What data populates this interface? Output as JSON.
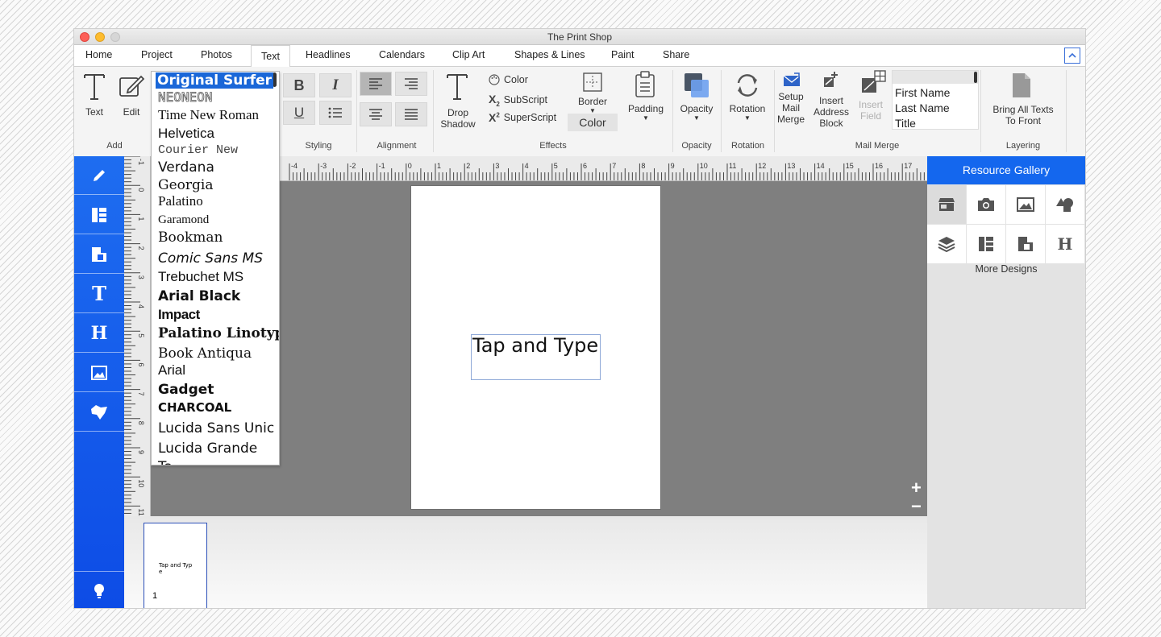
{
  "window": {
    "title": "The Print Shop"
  },
  "menu": [
    {
      "label": "Home"
    },
    {
      "label": "Project"
    },
    {
      "label": "Photos"
    },
    {
      "label": "Text"
    },
    {
      "label": "Headlines"
    },
    {
      "label": "Calendars"
    },
    {
      "label": "Clip Art"
    },
    {
      "label": "Shapes & Lines"
    },
    {
      "label": "Paint"
    },
    {
      "label": "Share"
    }
  ],
  "active_menu": "Text",
  "ribbon": {
    "add": {
      "text_label": "Text",
      "edit_label": "Edit",
      "group": "Add"
    },
    "styling_group": "Styling",
    "alignment_group": "Alignment",
    "effects": {
      "drop_shadow_1": "Drop",
      "drop_shadow_2": "Shadow",
      "color": "Color",
      "subscript": "SubScript",
      "superscript": "SuperScript",
      "border": "Border",
      "border_color": "Color",
      "padding": "Padding",
      "group": "Effects"
    },
    "opacity": {
      "label": "Opacity",
      "group": "Opacity"
    },
    "rotation": {
      "label": "Rotation",
      "group": "Rotation"
    },
    "mail_merge": {
      "setup_1": "Setup",
      "setup_2": "Mail",
      "setup_3": "Merge",
      "insert_1": "Insert",
      "insert_2": "Address",
      "insert_3": "Block",
      "field_1": "Insert",
      "field_2": "Field",
      "fields": [
        "First Name",
        "Last Name",
        "Title"
      ],
      "group": "Mail Merge"
    },
    "layering": {
      "label_1": "Bring All Texts",
      "label_2": "To Front",
      "group": "Layering"
    }
  },
  "fonts": [
    "Original Surfer",
    "NEONEON",
    "Time New Roman",
    "Helvetica",
    "Courier New",
    "Verdana",
    "Georgia",
    "Palatino",
    "Garamond",
    "Bookman",
    "Comic Sans MS",
    "Trebuchet MS",
    "Arial Black",
    "Impact",
    "Palatino Linotype",
    "Book Antiqua",
    "Arial",
    "Gadget",
    "CHARCOAL",
    "Lucida Sans Unic",
    "Lucida Grande",
    "Ta"
  ],
  "selected_font": "Original Surfer",
  "ruler": {
    "h_ticks": [
      "-4",
      "-3",
      "-2",
      "-1",
      "0",
      "1",
      "2",
      "3",
      "4",
      "5",
      "6",
      "7",
      "8",
      "9",
      "10",
      "11",
      "12",
      "13",
      "14",
      "15",
      "16",
      "17"
    ],
    "v_ticks": [
      "-1",
      "0",
      "1",
      "2",
      "3",
      "4",
      "5",
      "6",
      "7",
      "8",
      "9",
      "10",
      "11"
    ]
  },
  "canvas": {
    "text": "Tap and Type",
    "zoom_in": "+",
    "zoom_out": "−"
  },
  "thumbnails": [
    {
      "text": "Tap and Typ e",
      "page_number": "1"
    }
  ],
  "gallery": {
    "title": "Resource Gallery",
    "more": "More Designs"
  },
  "colors": {
    "accent": "#1467ee",
    "selection": "#1a67d8",
    "canvas_bg": "#7f7f7f"
  }
}
